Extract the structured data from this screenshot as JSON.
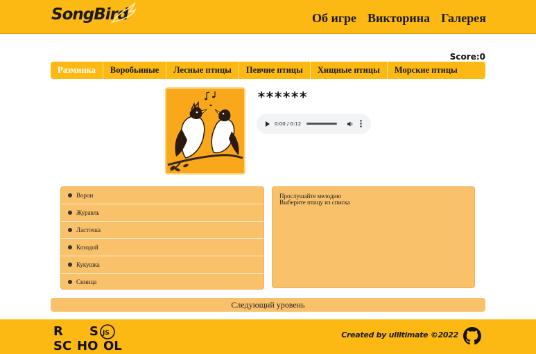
{
  "header": {
    "logo_text": "SongBird",
    "nav": [
      "Об игре",
      "Викторина",
      "Галерея"
    ]
  },
  "score": {
    "label": "Score:",
    "value": "0"
  },
  "levels": [
    "Разминка",
    "Воробьиные",
    "Лесные птицы",
    "Певчие птицы",
    "Хищные птицы",
    "Морские птицы"
  ],
  "active_level": 0,
  "question": {
    "hidden_name": "******",
    "audio": {
      "time": "0:00 / 0:12",
      "progress": 0
    }
  },
  "answers": [
    "Ворон",
    "Журавль",
    "Ласточка",
    "Козодой",
    "Кукушка",
    "Синица"
  ],
  "info": {
    "line1": "Прослушайте мелодию",
    "line2": "Выберите птицу из списка"
  },
  "next_button": "Следующий уровень",
  "footer": {
    "logo_letters": [
      "R",
      "S",
      "SC",
      "HO",
      "OL",
      "JS"
    ],
    "credit": "Created by ullltimate ©2022"
  },
  "colors": {
    "accent": "#fdb913",
    "panel": "#f9c16a",
    "bird_bg": "#f8a81a"
  },
  "icons": [
    "bird-logo-icon",
    "play-icon",
    "volume-icon",
    "more-options-icon",
    "github-icon"
  ]
}
